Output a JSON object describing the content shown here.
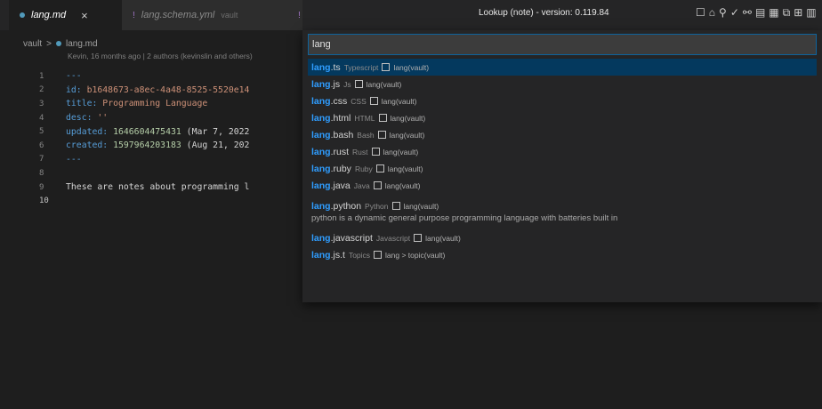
{
  "tabs": [
    {
      "label": "lang.md",
      "close": "×"
    },
    {
      "label": "lang.schema.yml",
      "suffix": "vault"
    }
  ],
  "breadcrumb": {
    "root": "vault",
    "sep": ">",
    "file": "lang.md"
  },
  "blame": "Kevin, 16 months ago | 2 authors (kevinslin and others)",
  "code": {
    "lines": [
      {
        "num": "1",
        "segments": [
          {
            "t": "---",
            "c": "dash"
          }
        ]
      },
      {
        "num": "2",
        "segments": [
          {
            "t": "id: ",
            "c": "k"
          },
          {
            "t": "b1648673-a8ec-4a48-8525-5520e14",
            "c": "v"
          }
        ]
      },
      {
        "num": "3",
        "segments": [
          {
            "t": "title: ",
            "c": "k"
          },
          {
            "t": "Programming Language",
            "c": "v"
          }
        ]
      },
      {
        "num": "4",
        "segments": [
          {
            "t": "desc: ",
            "c": "k"
          },
          {
            "t": "''",
            "c": "v"
          }
        ]
      },
      {
        "num": "5",
        "segments": [
          {
            "t": "updated: ",
            "c": "k"
          },
          {
            "t": "1646604475431",
            "c": "n"
          },
          {
            "t": " (Mar 7, 2022",
            "c": "txt"
          }
        ]
      },
      {
        "num": "6",
        "segments": [
          {
            "t": "created: ",
            "c": "k"
          },
          {
            "t": "1597964203183",
            "c": "n"
          },
          {
            "t": " (Aug 21, 202",
            "c": "txt"
          }
        ]
      },
      {
        "num": "7",
        "segments": [
          {
            "t": "---",
            "c": "dash"
          }
        ]
      },
      {
        "num": "8",
        "segments": []
      },
      {
        "num": "9",
        "segments": [
          {
            "t": "These are notes about programming l",
            "c": "txt"
          }
        ]
      },
      {
        "num": "10",
        "segments": [],
        "current": true
      }
    ]
  },
  "picker": {
    "title": "Lookup (note) - version: 0.119.84",
    "query": "lang",
    "items": [
      {
        "hl": "lang",
        "rest": ".ts",
        "desc": "Typescript",
        "detail": "lang(vault)",
        "selected": true
      },
      {
        "hl": "lang",
        "rest": ".js",
        "desc": "Js",
        "detail": "lang(vault)"
      },
      {
        "hl": "lang",
        "rest": ".css",
        "desc": "CSS",
        "detail": "lang(vault)"
      },
      {
        "hl": "lang",
        "rest": ".html",
        "desc": "HTML",
        "detail": "lang(vault)"
      },
      {
        "hl": "lang",
        "rest": ".bash",
        "desc": "Bash",
        "detail": "lang(vault)"
      },
      {
        "hl": "lang",
        "rest": ".rust",
        "desc": "Rust",
        "detail": "lang(vault)"
      },
      {
        "hl": "lang",
        "rest": ".ruby",
        "desc": "Ruby",
        "detail": "lang(vault)"
      },
      {
        "hl": "lang",
        "rest": ".java",
        "desc": "Java",
        "detail": "lang(vault)"
      },
      {
        "hl": "lang",
        "rest": ".python",
        "desc": "Python",
        "detail": "lang(vault)",
        "extra": "python is a dynamic general purpose programming language with batteries built in"
      },
      {
        "hl": "lang",
        "rest": ".javascript",
        "desc": "Javascript",
        "detail": "lang(vault)"
      },
      {
        "hl": "lang",
        "rest": ".js.t",
        "desc": "Topics",
        "detail": "lang > topic(vault)"
      }
    ]
  },
  "toolbar_icons": [
    "square-icon",
    "building-icon",
    "pin-icon",
    "check-icon",
    "link-icon",
    "split-icon",
    "table-icon",
    "copy-icon",
    "plus-box-icon",
    "grid-icon"
  ],
  "colors": {
    "accent": "#2f9dff",
    "selection": "#04395e",
    "focus_border": "#0e639c"
  }
}
